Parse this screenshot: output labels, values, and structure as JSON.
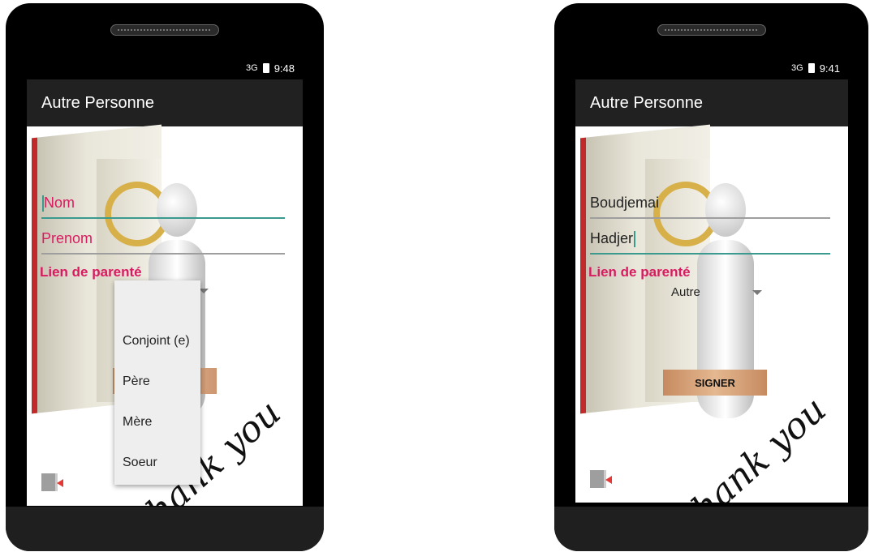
{
  "left": {
    "status": {
      "signal": "3G",
      "time": "9:48"
    },
    "title": "Autre Personne",
    "nom_placeholder": "Nom",
    "prenom_placeholder": "Prenom",
    "lien_label": "Lien de parenté",
    "dropdown_options": [
      "Conjoint (e)",
      "Père",
      "Mère",
      "Soeur"
    ],
    "watermark": "Thank you"
  },
  "right": {
    "status": {
      "signal": "3G",
      "time": "9:41"
    },
    "title": "Autre Personne",
    "nom_value": "Boudjemai",
    "prenom_value": "Hadjer",
    "lien_label": "Lien de parenté",
    "spinner_value": "Autre",
    "signer_label": "SIGNER",
    "watermark": "Thank you"
  },
  "colors": {
    "accent_pink": "#d81b60",
    "accent_teal": "#3a9a8e",
    "appbar": "#212121"
  }
}
